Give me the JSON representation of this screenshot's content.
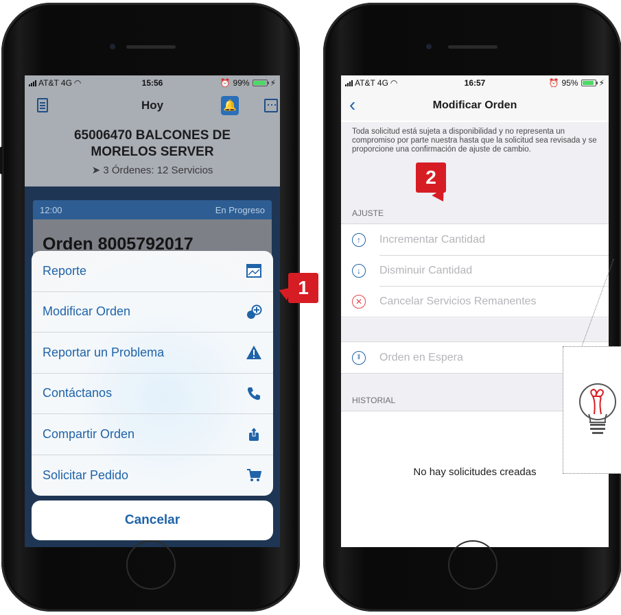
{
  "left_phone": {
    "status": {
      "carrier": "AT&T 4G",
      "time": "15:56",
      "battery": "99%",
      "battery_level": 0.99
    },
    "nav": {
      "title": "Hoy",
      "icons": [
        "clipboard-icon",
        "bell-icon",
        "calendar-icon"
      ]
    },
    "header": {
      "store": "65006470 BALCONES DE MORELOS SERVER",
      "summary": "3 Órdenes: 12 Servicios"
    },
    "card": {
      "time": "12:00",
      "status": "En Progreso",
      "order": "Orden 8005792017"
    },
    "action_sheet": {
      "items": [
        {
          "label": "Reporte",
          "icon": "chart-icon"
        },
        {
          "label": "Modificar Orden",
          "icon": "add-pills-icon"
        },
        {
          "label": "Reportar un Problema",
          "icon": "warning-icon"
        },
        {
          "label": "Contáctanos",
          "icon": "phone-icon"
        },
        {
          "label": "Compartir Orden",
          "icon": "share-icon"
        },
        {
          "label": "Solicitar Pedido",
          "icon": "cart-icon"
        }
      ],
      "cancel": "Cancelar"
    }
  },
  "right_phone": {
    "status": {
      "carrier": "AT&T 4G",
      "time": "16:57",
      "battery": "95%",
      "battery_level": 0.95
    },
    "nav": {
      "title": "Modificar Orden"
    },
    "disclaimer": "Toda solicitud está sujeta a disponibilidad y no representa un compromiso por parte nuestra hasta que la solicitud sea revisada y se proporcione una confirmación de ajuste de cambio.",
    "section_ajuste": "AJUSTE",
    "ajuste_options": [
      {
        "label": "Incrementar Cantidad",
        "icon": "arrow-up-circle-icon"
      },
      {
        "label": "Disminuir Cantidad",
        "icon": "arrow-down-circle-icon"
      },
      {
        "label": "Cancelar Servicios Remanentes",
        "icon": "x-circle-icon"
      }
    ],
    "hold_option": {
      "label": "Orden en Espera",
      "icon": "pause-circle-icon"
    },
    "section_historial": "HISTORIAL",
    "empty_text": "No hay solicitudes creadas"
  },
  "callouts": {
    "badge_1": "1",
    "badge_2": "2",
    "accent": "#d71d24"
  }
}
